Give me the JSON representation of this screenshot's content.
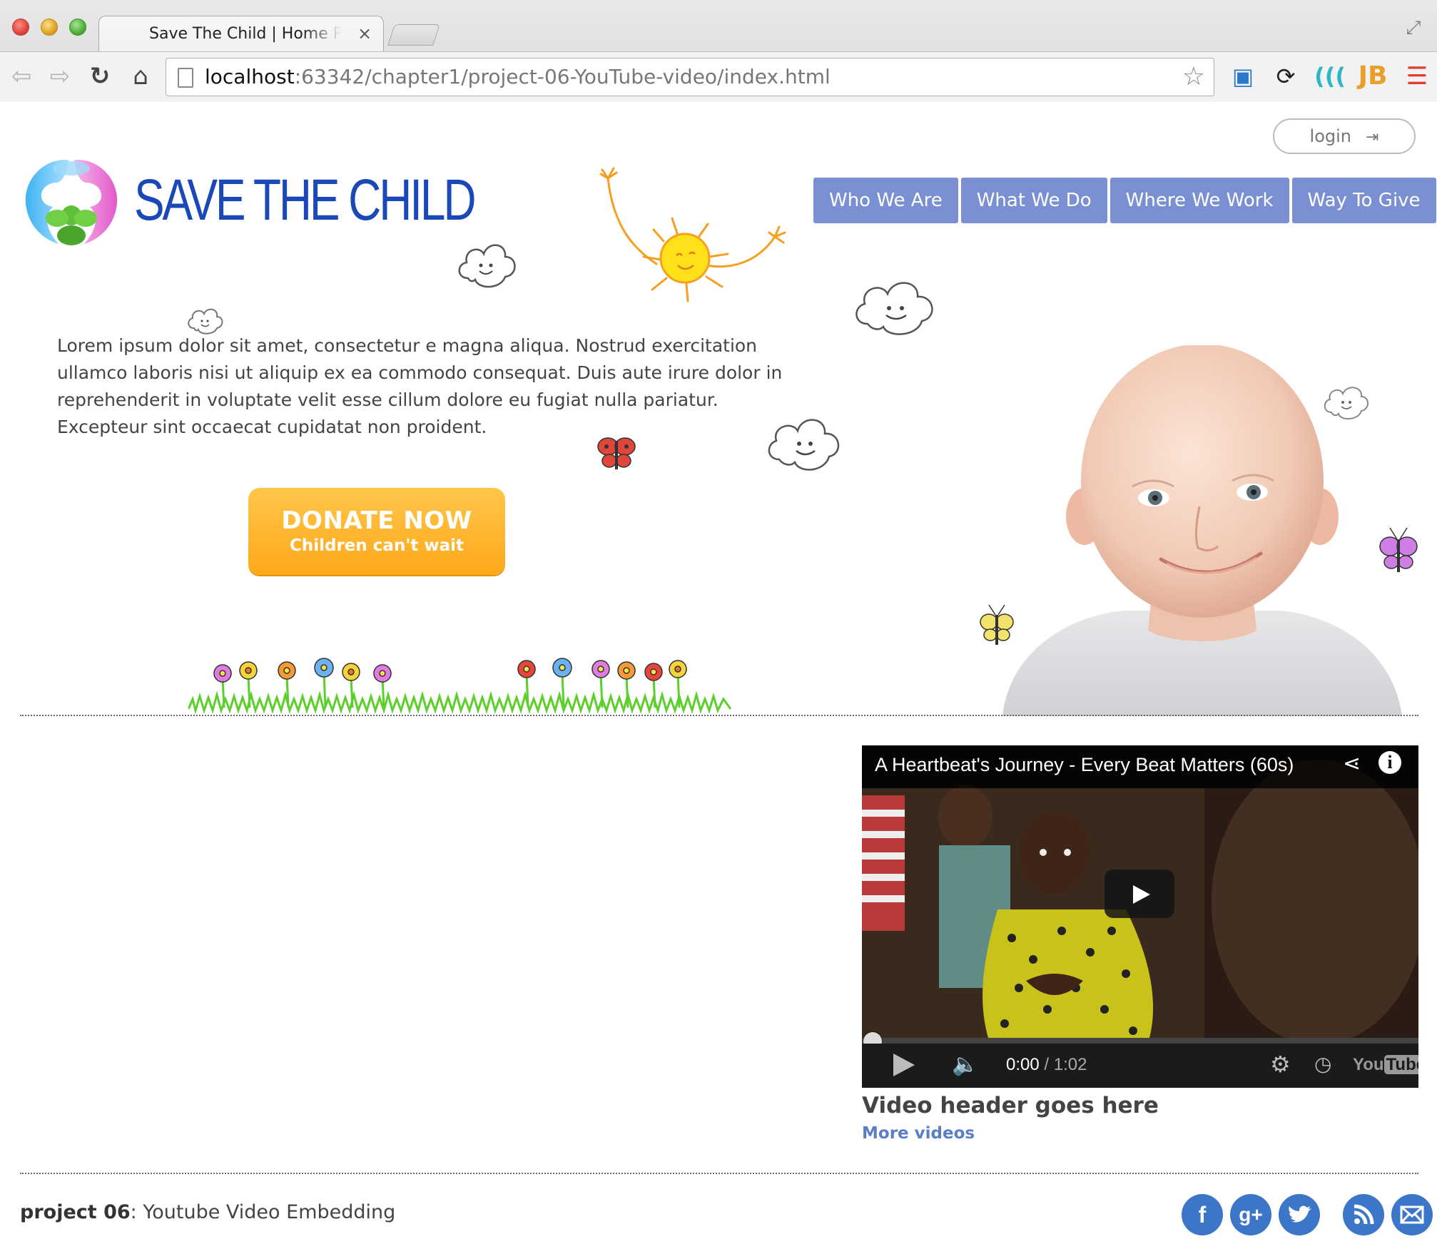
{
  "browser": {
    "tab_title": "Save The Child | Home Page",
    "tab_close": "×",
    "url_host": "localhost",
    "url_rest": ":63342/chapter1/project-06-YouTube-video/index.html",
    "icons": {
      "back": "back-arrow-icon",
      "forward": "forward-arrow-icon",
      "reload": "reload-icon",
      "home": "home-icon",
      "star": "bookmark-star-icon",
      "menu": "hamburger-menu-icon"
    }
  },
  "header": {
    "login_label": "login",
    "logo_text": "SAVE THE CHILD",
    "nav": [
      {
        "label": "Who We Are"
      },
      {
        "label": "What We Do"
      },
      {
        "label": "Where We Work"
      },
      {
        "label": "Way To Give"
      }
    ],
    "nav_color": "#7b8fd3"
  },
  "main": {
    "intro": "Lorem ipsum dolor sit amet, consectetur e magna aliqua. Nostrud exercitation ullamco laboris nisi ut aliquip ex ea commodo consequat. Duis aute irure dolor in reprehenderit in voluptate velit esse cillum dolore eu fugiat nulla pariatur. Excepteur sint occaecat cupidatat non proident.",
    "donate_title": "DONATE NOW",
    "donate_subtitle": "Children can't wait",
    "donate_color": "#ffa81a"
  },
  "video": {
    "title": "A Heartbeat's Journey - Every Beat Matters (60s)",
    "time_current": "0:00",
    "time_total": " / 1:02",
    "logo_you": "You",
    "logo_tube": "Tube",
    "progress": 0,
    "header": "Video header goes here",
    "more_link": "More videos"
  },
  "footer": {
    "project_label": "project 06",
    "project_desc": ": Youtube Video Embedding",
    "social": [
      "facebook-icon",
      "google-plus-icon",
      "twitter-icon",
      "rss-icon",
      "email-icon"
    ]
  }
}
